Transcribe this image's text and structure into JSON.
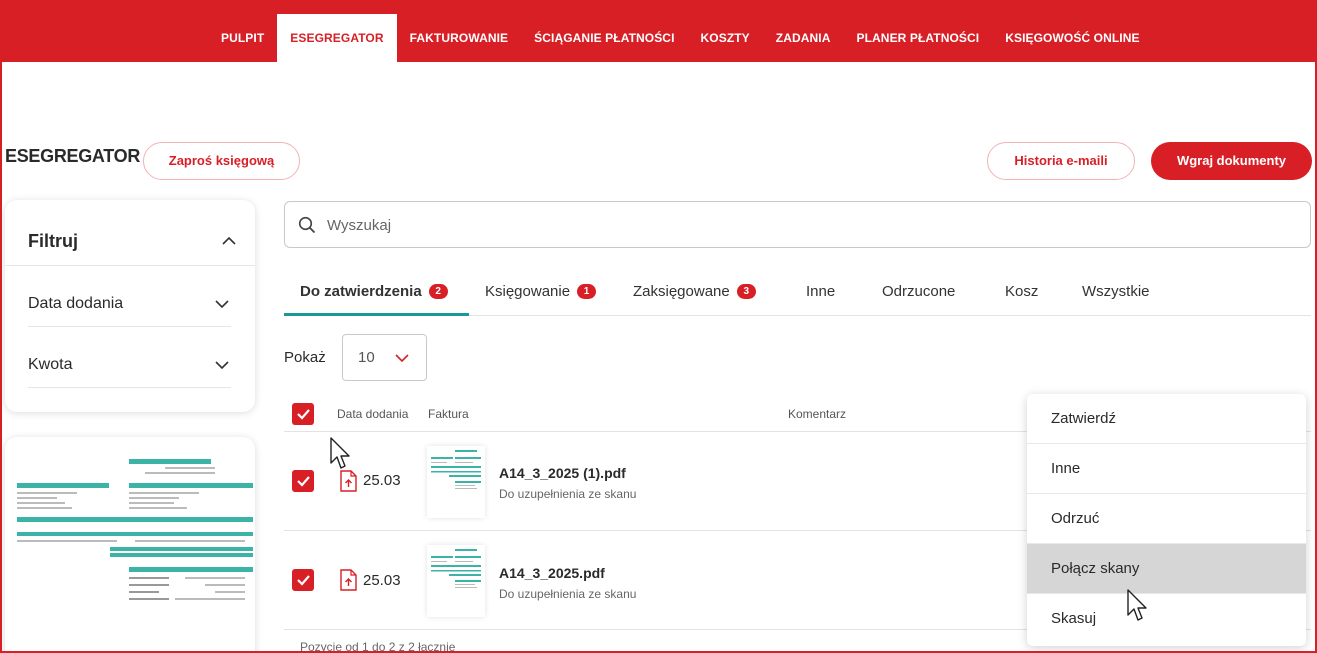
{
  "nav": {
    "items": [
      {
        "label": "PULPIT",
        "active": false
      },
      {
        "label": "ESEGREGATOR",
        "active": true
      },
      {
        "label": "FAKTUROWANIE",
        "active": false
      },
      {
        "label": "ŚCIĄGANIE PŁATNOŚCI",
        "active": false
      },
      {
        "label": "KOSZTY",
        "active": false
      },
      {
        "label": "ZADANIA",
        "active": false
      },
      {
        "label": "PLANER PŁATNOŚCI",
        "active": false
      },
      {
        "label": "KSIĘGOWOŚĆ ONLINE",
        "active": false
      }
    ]
  },
  "header": {
    "title": "ESEGREGATOR",
    "invite_button": "Zaproś księgową",
    "history_button": "Historia e-maili",
    "upload_button": "Wgraj dokumenty"
  },
  "filter": {
    "title": "Filtruj",
    "rows": [
      "Data dodania",
      "Kwota"
    ]
  },
  "search": {
    "placeholder": "Wyszukaj"
  },
  "tabs": [
    {
      "label": "Do zatwierdzenia",
      "badge": "2",
      "active": true
    },
    {
      "label": "Księgowanie",
      "badge": "1",
      "active": false
    },
    {
      "label": "Zaksięgowane",
      "badge": "3",
      "active": false
    },
    {
      "label": "Inne",
      "badge": null,
      "active": false
    },
    {
      "label": "Odrzucone",
      "badge": null,
      "active": false
    },
    {
      "label": "Kosz",
      "badge": null,
      "active": false
    },
    {
      "label": "Wszystkie",
      "badge": null,
      "active": false
    }
  ],
  "show": {
    "label": "Pokaż",
    "value": "10"
  },
  "table": {
    "columns": [
      "Data dodania",
      "Faktura",
      "Komentarz"
    ],
    "rows": [
      {
        "date": "25.03",
        "filename": "A14_3_2025 (1).pdf",
        "status": "Do uzupełnienia ze skanu",
        "checked": true
      },
      {
        "date": "25.03",
        "filename": "A14_3_2025.pdf",
        "status": "Do uzupełnienia ze skanu",
        "checked": true
      }
    ],
    "footer": "Pozycje od 1 do 2 z 2 łącznie"
  },
  "context_menu": {
    "items": [
      "Zatwierdź",
      "Inne",
      "Odrzuć",
      "Połącz skany",
      "Skasuj"
    ],
    "hovered": "Połącz skany"
  },
  "colors": {
    "brand": "#d81f26",
    "accent": "#1a9a94",
    "menu_hover": "#d6d6d6"
  }
}
